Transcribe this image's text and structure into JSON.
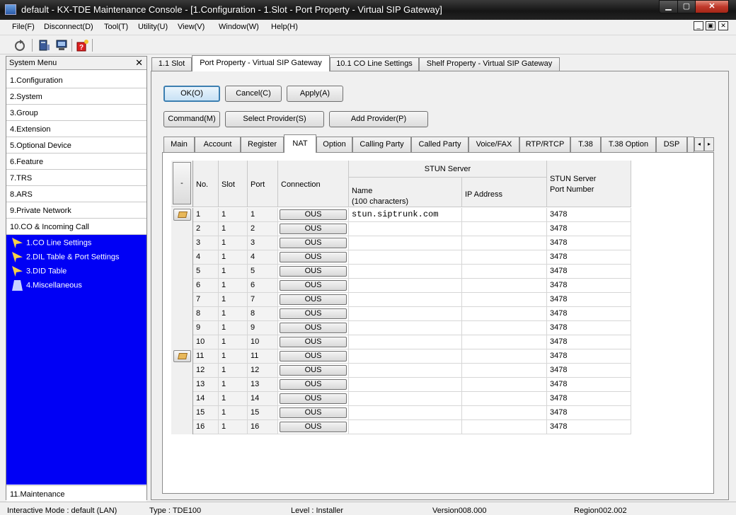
{
  "window": {
    "title": "default - KX-TDE Maintenance Console - [1.Configuration - 1.Slot - Port Property - Virtual SIP Gateway]",
    "min_glyph": "▁",
    "max_glyph": "▢",
    "close_glyph": "✕"
  },
  "menu": [
    "File(F)",
    "Disconnect(D)",
    "Tool(T)",
    "Utility(U)",
    "View(V)",
    "Window(W)",
    "Help(H)"
  ],
  "mdi": {
    "min": "_",
    "restore": "▣",
    "close": "✕"
  },
  "toolbar_icons": [
    "refresh-icon",
    "pc-icon",
    "monitor-icon",
    "help-icon"
  ],
  "system_menu": {
    "title": "System Menu",
    "close_glyph": "✕",
    "items": [
      "1.Configuration",
      "2.System",
      "3.Group",
      "4.Extension",
      "5.Optional Device",
      "6.Feature",
      "7.TRS",
      "8.ARS",
      "9.Private Network",
      "10.CO & Incoming Call"
    ],
    "sub_items": [
      "1.CO Line Settings",
      "2.DIL Table & Port Settings",
      "3.DID Table",
      "4.Miscellaneous"
    ],
    "bottom_item": "11.Maintenance"
  },
  "top_tabs": [
    "1.1 Slot",
    "Port Property - Virtual SIP Gateway",
    "10.1 CO Line Settings",
    "Shelf Property - Virtual SIP Gateway"
  ],
  "buttons": {
    "ok": "OK(O)",
    "cancel": "Cancel(C)",
    "apply": "Apply(A)",
    "command": "Command(M)",
    "select_provider": "Select Provider(S)",
    "add_provider": "Add Provider(P)"
  },
  "inner_tabs": [
    "Main",
    "Account",
    "Register",
    "NAT",
    "Option",
    "Calling Party",
    "Called Party",
    "Voice/FAX",
    "RTP/RTCP",
    "T.38",
    "T.38 Option",
    "DSP"
  ],
  "scroll": {
    "left": "◂",
    "right": "▸"
  },
  "grid": {
    "corner": "-",
    "headers": {
      "no": "No.",
      "slot": "Slot",
      "port": "Port",
      "connection": "Connection",
      "stun_group": "STUN Server",
      "name_line1": "Name",
      "name_line2": "(100 characters)",
      "ip": "IP Address",
      "port_num_line1": "STUN Server",
      "port_num_line2": "Port Number"
    },
    "rows": [
      {
        "no": "1",
        "slot": "1",
        "port": "1",
        "connection": "OUS",
        "name": "stun.siptrunk.com",
        "ip": "",
        "stun_port": "3478"
      },
      {
        "no": "2",
        "slot": "1",
        "port": "2",
        "connection": "OUS",
        "name": "",
        "ip": "",
        "stun_port": "3478"
      },
      {
        "no": "3",
        "slot": "1",
        "port": "3",
        "connection": "OUS",
        "name": "",
        "ip": "",
        "stun_port": "3478"
      },
      {
        "no": "4",
        "slot": "1",
        "port": "4",
        "connection": "OUS",
        "name": "",
        "ip": "",
        "stun_port": "3478"
      },
      {
        "no": "5",
        "slot": "1",
        "port": "5",
        "connection": "OUS",
        "name": "",
        "ip": "",
        "stun_port": "3478"
      },
      {
        "no": "6",
        "slot": "1",
        "port": "6",
        "connection": "OUS",
        "name": "",
        "ip": "",
        "stun_port": "3478"
      },
      {
        "no": "7",
        "slot": "1",
        "port": "7",
        "connection": "OUS",
        "name": "",
        "ip": "",
        "stun_port": "3478"
      },
      {
        "no": "8",
        "slot": "1",
        "port": "8",
        "connection": "OUS",
        "name": "",
        "ip": "",
        "stun_port": "3478"
      },
      {
        "no": "9",
        "slot": "1",
        "port": "9",
        "connection": "OUS",
        "name": "",
        "ip": "",
        "stun_port": "3478"
      },
      {
        "no": "10",
        "slot": "1",
        "port": "10",
        "connection": "OUS",
        "name": "",
        "ip": "",
        "stun_port": "3478"
      },
      {
        "no": "11",
        "slot": "1",
        "port": "11",
        "connection": "OUS",
        "name": "",
        "ip": "",
        "stun_port": "3478"
      },
      {
        "no": "12",
        "slot": "1",
        "port": "12",
        "connection": "OUS",
        "name": "",
        "ip": "",
        "stun_port": "3478"
      },
      {
        "no": "13",
        "slot": "1",
        "port": "13",
        "connection": "OUS",
        "name": "",
        "ip": "",
        "stun_port": "3478"
      },
      {
        "no": "14",
        "slot": "1",
        "port": "14",
        "connection": "OUS",
        "name": "",
        "ip": "",
        "stun_port": "3478"
      },
      {
        "no": "15",
        "slot": "1",
        "port": "15",
        "connection": "OUS",
        "name": "",
        "ip": "",
        "stun_port": "3478"
      },
      {
        "no": "16",
        "slot": "1",
        "port": "16",
        "connection": "OUS",
        "name": "",
        "ip": "",
        "stun_port": "3478"
      }
    ]
  },
  "status": {
    "mode": "Interactive Mode : default (LAN)",
    "type": "Type : TDE100",
    "level": "Level : Installer",
    "version": "Version008.000",
    "region": "Region002.002"
  },
  "colors": {
    "submenu_bg": "#0000f5"
  }
}
